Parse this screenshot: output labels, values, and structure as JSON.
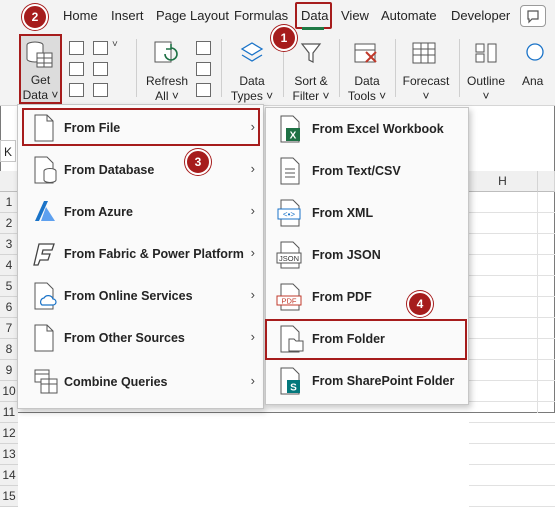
{
  "tabs": [
    "Home",
    "Insert",
    "Page Layout",
    "Formulas",
    "Data",
    "View",
    "Automate",
    "Developer"
  ],
  "ribbon": {
    "get_data": [
      "Get",
      "Data ˅"
    ],
    "refresh_all": [
      "Refresh",
      "All ˅"
    ],
    "data_types": [
      "Data",
      "Types ˅"
    ],
    "sort_filter": [
      "Sort &",
      "Filter ˅"
    ],
    "data_tools": [
      "Data",
      "Tools ˅"
    ],
    "forecast": [
      "Forecast",
      "˅"
    ],
    "outline": [
      "Outline",
      "˅"
    ],
    "analysis_partial": "Ana"
  },
  "sheet": {
    "namebox_char": "K",
    "column_header_h": "H",
    "row_numbers": [
      "1",
      "2",
      "3",
      "4",
      "5",
      "6",
      "7",
      "8",
      "9",
      "10",
      "11",
      "12",
      "13",
      "14",
      "15"
    ]
  },
  "get_data_menu": [
    "From File",
    "From Database",
    "From Azure",
    "From Fabric & Power Platform",
    "From Online Services",
    "From Other Sources",
    "Combine Queries"
  ],
  "from_file_menu": [
    "From Excel Workbook",
    "From Text/CSV",
    "From XML",
    "From JSON",
    "From PDF",
    "From Folder",
    "From SharePoint Folder"
  ],
  "icon_text": {
    "excel": "X",
    "xml": "<•>",
    "json": "JSON",
    "pdf": "PDF",
    "sharepoint": "S"
  },
  "steps": [
    "1",
    "2",
    "3",
    "4"
  ],
  "colors": {
    "highlight": "#a61c1c",
    "excel_green": "#1e7145",
    "azure_blue": "#1a73c8",
    "sharepoint": "#03787c"
  }
}
